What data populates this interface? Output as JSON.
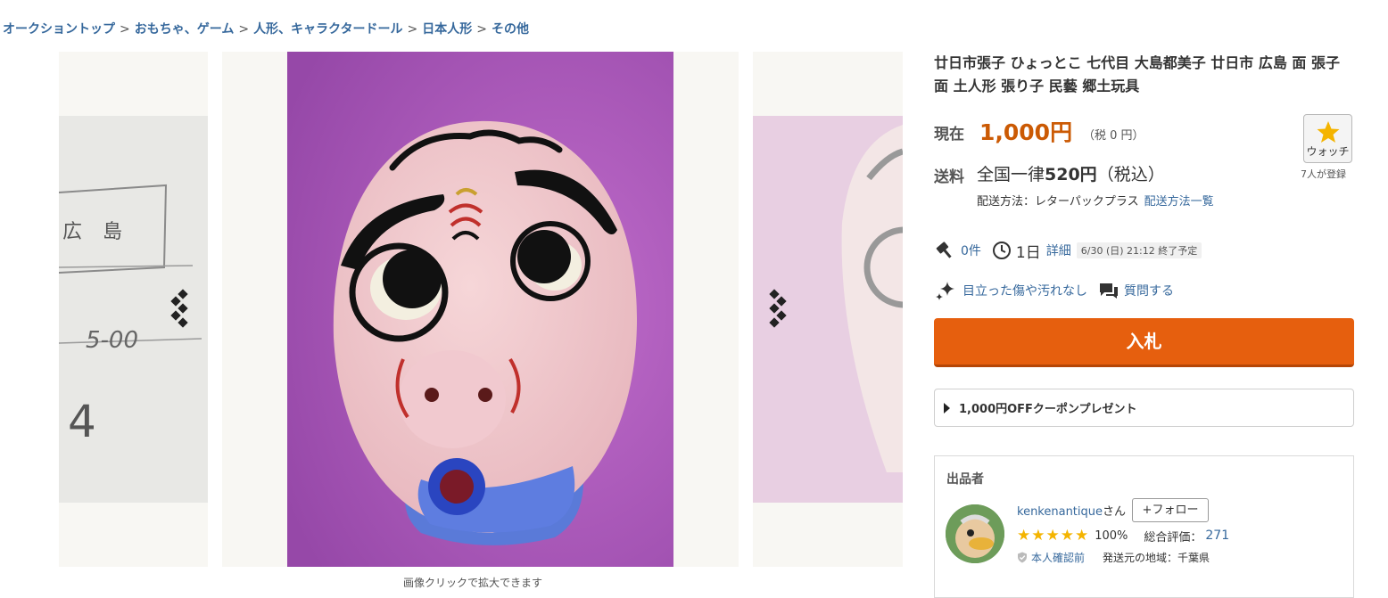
{
  "breadcrumb": {
    "items": [
      "オークショントップ",
      "おもちゃ、ゲーム",
      "人形、キャラクタードール",
      "日本人形",
      "その他"
    ],
    "separator": ">"
  },
  "gallery": {
    "caption": "画像クリックで拡大できます",
    "left_image_text": "広 島"
  },
  "item": {
    "title": "廿日市張子 ひょっとこ 七代目 大島都美子 廿日市 広島 面 張子面 土人形 張り子 民藝 郷土玩具",
    "price_label": "現在",
    "price": "1,000円",
    "tax": "（税 0 円）",
    "shipping_label": "送料",
    "shipping_prefix": "全国一律",
    "shipping_amount": "520円",
    "shipping_suffix": "（税込）",
    "shipping_method": "配送方法：レターパックプラス",
    "shipping_list_link": "配送方法一覧",
    "bid_count": "0件",
    "time_left": "1日",
    "detail_link": "詳細",
    "end_time": "6/30 (日) 21:12 終了予定",
    "condition": "目立った傷や汚れなし",
    "question_link": "質問する"
  },
  "watch": {
    "label": "ウォッチ",
    "count": "7人が登録"
  },
  "bid_button": {
    "label": "入札"
  },
  "coupon": {
    "text": "1,000円OFFクーポンプレゼント"
  },
  "seller": {
    "heading": "出品者",
    "name": "kenkenantique",
    "suffix": "さん",
    "follow": "+フォロー",
    "stars": "★★★★★",
    "percent": "100%",
    "total_label": "総合評価：",
    "total_value": "271",
    "verification": "本人確認前",
    "region": "発送元の地域：千葉県"
  },
  "colors": {
    "accent": "#e65f0e",
    "price": "#cb5a04",
    "link": "#36689c",
    "star": "#f4b400"
  }
}
